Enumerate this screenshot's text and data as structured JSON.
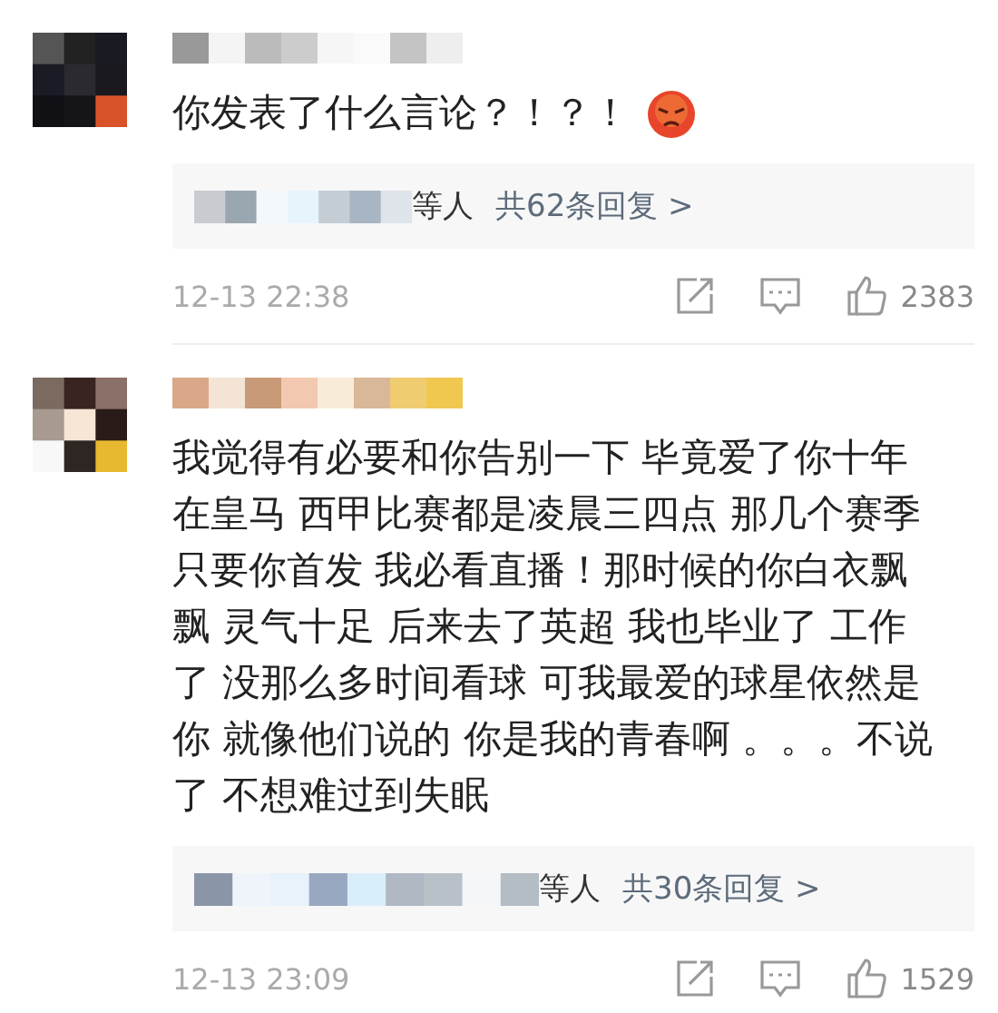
{
  "comments": [
    {
      "text": "你发表了什么言论？！？！",
      "emoji": true,
      "replies": {
        "suffix": "等人",
        "count": "共62条回复 >"
      },
      "time": "12-13 22:38",
      "likes": "2383"
    },
    {
      "text": "我觉得有必要和你告别一下 毕竟爱了你十年在皇马 西甲比赛都是凌晨三四点 那几个赛季只要你首发 我必看直播！那时候的你白衣飘飘 灵气十足 后来去了英超 我也毕业了 工作了 没那么多时间看球 可我最爱的球星依然是你 就像他们说的 你是我的青春啊 。。。不说了 不想难过到失眠",
      "replies": {
        "suffix": "等人",
        "count": "共30条回复 >"
      },
      "time": "12-13 23:09",
      "likes": "1529"
    }
  ]
}
